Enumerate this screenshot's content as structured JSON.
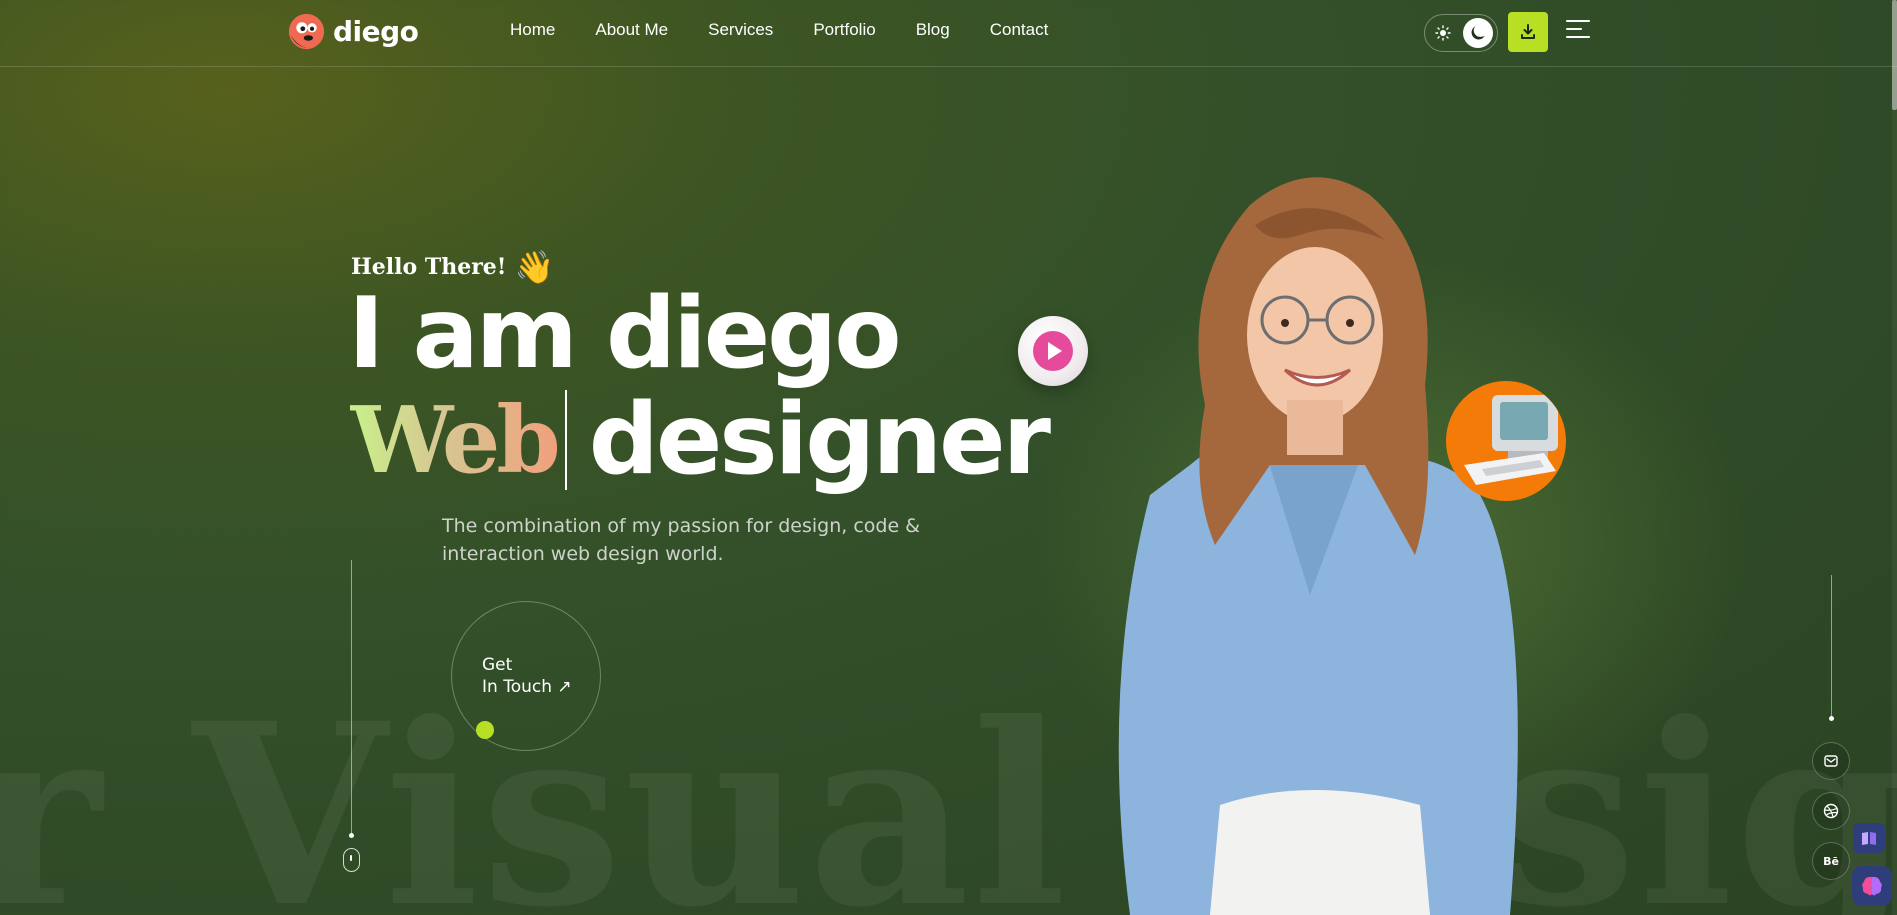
{
  "brand": {
    "name": "diego"
  },
  "nav": {
    "items": [
      "Home",
      "About Me",
      "Services",
      "Portfolio",
      "Blog",
      "Contact"
    ]
  },
  "header": {
    "theme_toggle": {
      "left_icon": "sun-icon",
      "right_icon": "moon-icon",
      "active": "dark"
    },
    "download_icon": "download-icon",
    "menu_icon": "hamburger-menu-icon"
  },
  "hero": {
    "greeting": "Hello There!",
    "greeting_emoji": "👋",
    "headline_line1": "I am diego",
    "headline_role_word": "Web",
    "headline_role_rest": "designer",
    "subtitle": "The combination of my passion for design, code & interaction web design world.",
    "cta_line1": "Get",
    "cta_line2": "In Touch",
    "cta_arrow": "↗",
    "background_word": "r Visual designe"
  },
  "social": {
    "items": [
      "mail-icon",
      "dribbble-icon",
      "behance-icon"
    ],
    "behance_text": "Bē"
  },
  "colors": {
    "accent": "#b7e024",
    "badge_orange": "#f57b08",
    "background": "#33502a"
  }
}
